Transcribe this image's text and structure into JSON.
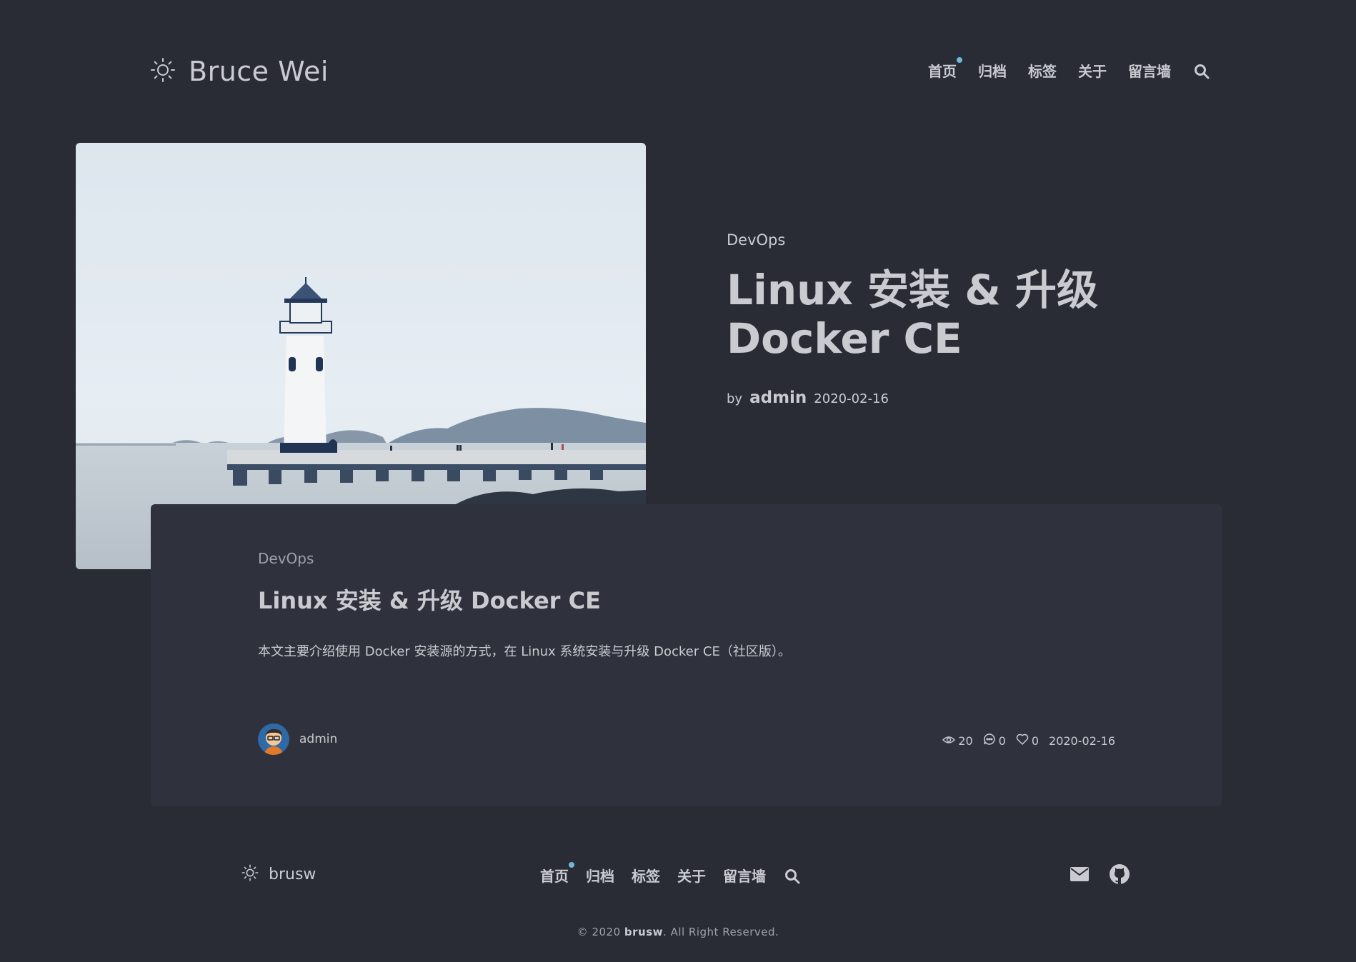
{
  "colors": {
    "background": "#292c35",
    "card_background": "#2f323d",
    "text": "#c9cbd1",
    "muted_text": "#9ea1a9",
    "accent_dot": "#6fb8d8"
  },
  "header": {
    "logo_icon": "sun-icon",
    "site_title": "Bruce Wei",
    "nav": [
      {
        "label": "首页",
        "active": true
      },
      {
        "label": "归档"
      },
      {
        "label": "标签"
      },
      {
        "label": "关于"
      },
      {
        "label": "留言墙"
      }
    ],
    "search_icon": "search-icon"
  },
  "hero": {
    "image": "lighthouse-photo",
    "category": "DevOps",
    "title": "Linux 安装 & 升级 Docker CE",
    "by_label": "by",
    "author": "admin",
    "date": "2020-02-16"
  },
  "card": {
    "category": "DevOps",
    "title": "Linux 安装 & 升级 Docker CE",
    "excerpt": "本文主要介绍使用 Docker 安装源的方式，在 Linux 系统安装与升级 Docker CE（社区版）。",
    "author": "admin",
    "views": "20",
    "comments": "0",
    "likes": "0",
    "date": "2020-02-16"
  },
  "footer": {
    "logo_icon": "sun-icon",
    "brand": "brusw",
    "nav": [
      {
        "label": "首页",
        "active": true
      },
      {
        "label": "归档"
      },
      {
        "label": "标签"
      },
      {
        "label": "关于"
      },
      {
        "label": "留言墙"
      }
    ],
    "search_icon": "search-icon",
    "social": [
      "mail-icon",
      "github-icon"
    ],
    "copyright_prefix": "© 2020",
    "copyright_name": "brusw",
    "copyright_suffix": ". All Right Reserved."
  }
}
